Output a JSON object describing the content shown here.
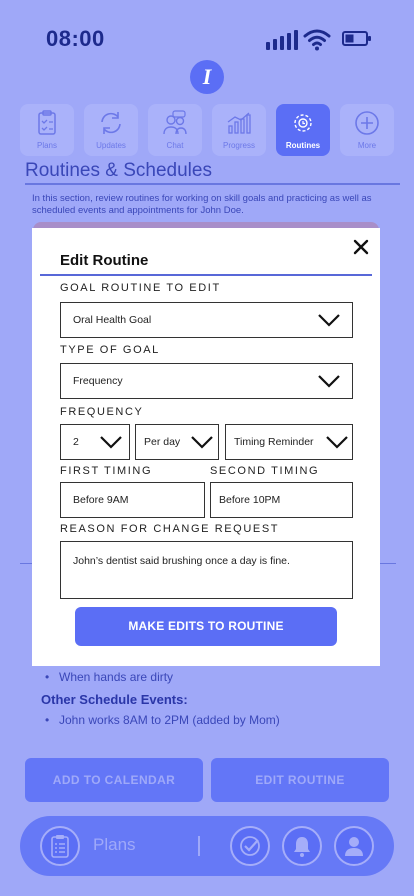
{
  "status_bar": {
    "time": "08:00"
  },
  "app": {
    "logo_letter": "I"
  },
  "tabs": [
    {
      "label": "Plans",
      "icon": "clipboard-icon",
      "active": false
    },
    {
      "label": "Updates",
      "icon": "refresh-icon",
      "active": false
    },
    {
      "label": "Chat",
      "icon": "chat-people-icon",
      "active": false
    },
    {
      "label": "Progress",
      "icon": "bar-chart-icon",
      "active": false
    },
    {
      "label": "Routines",
      "icon": "routine-clock-icon",
      "active": true
    },
    {
      "label": "More",
      "icon": "plus-circle-icon",
      "active": false
    }
  ],
  "page": {
    "title": "Routines & Schedules",
    "intro": "In this section, review routines for working on skill goals and practicing as well as scheduled events and appointments for John Doe."
  },
  "background": {
    "list_item": "When hands are dirty",
    "other_title": "Other Schedule Events:",
    "other_item": "John works 8AM to 2PM (added by Mom)",
    "add_calendar_label": "ADD TO CALENDAR",
    "edit_routine_label": "EDIT ROUTINE"
  },
  "modal": {
    "title": "Edit Routine",
    "goal_label": "GOAL ROUTINE TO EDIT",
    "goal_value": "Oral Health Goal",
    "type_label": "TYPE OF GOAL",
    "type_value": "Frequency",
    "frequency_label": "FREQUENCY",
    "frequency_count": "2",
    "frequency_period": "Per day",
    "frequency_mode": "Timing Reminder",
    "first_timing_label": "FIRST TIMING",
    "first_timing_value": "Before 9AM",
    "second_timing_label": "SECOND TIMING",
    "second_timing_value": "Before 10PM",
    "reason_label": "REASON FOR CHANGE REQUEST",
    "reason_value": "John’s dentist said brushing once a day is fine.",
    "submit_label": "MAKE EDITS TO ROUTINE"
  },
  "bottom_nav": {
    "label": "Plans"
  },
  "colors": {
    "background": "#9fa8f8",
    "accent": "#5b6ef5",
    "modal": "#ffffff"
  }
}
